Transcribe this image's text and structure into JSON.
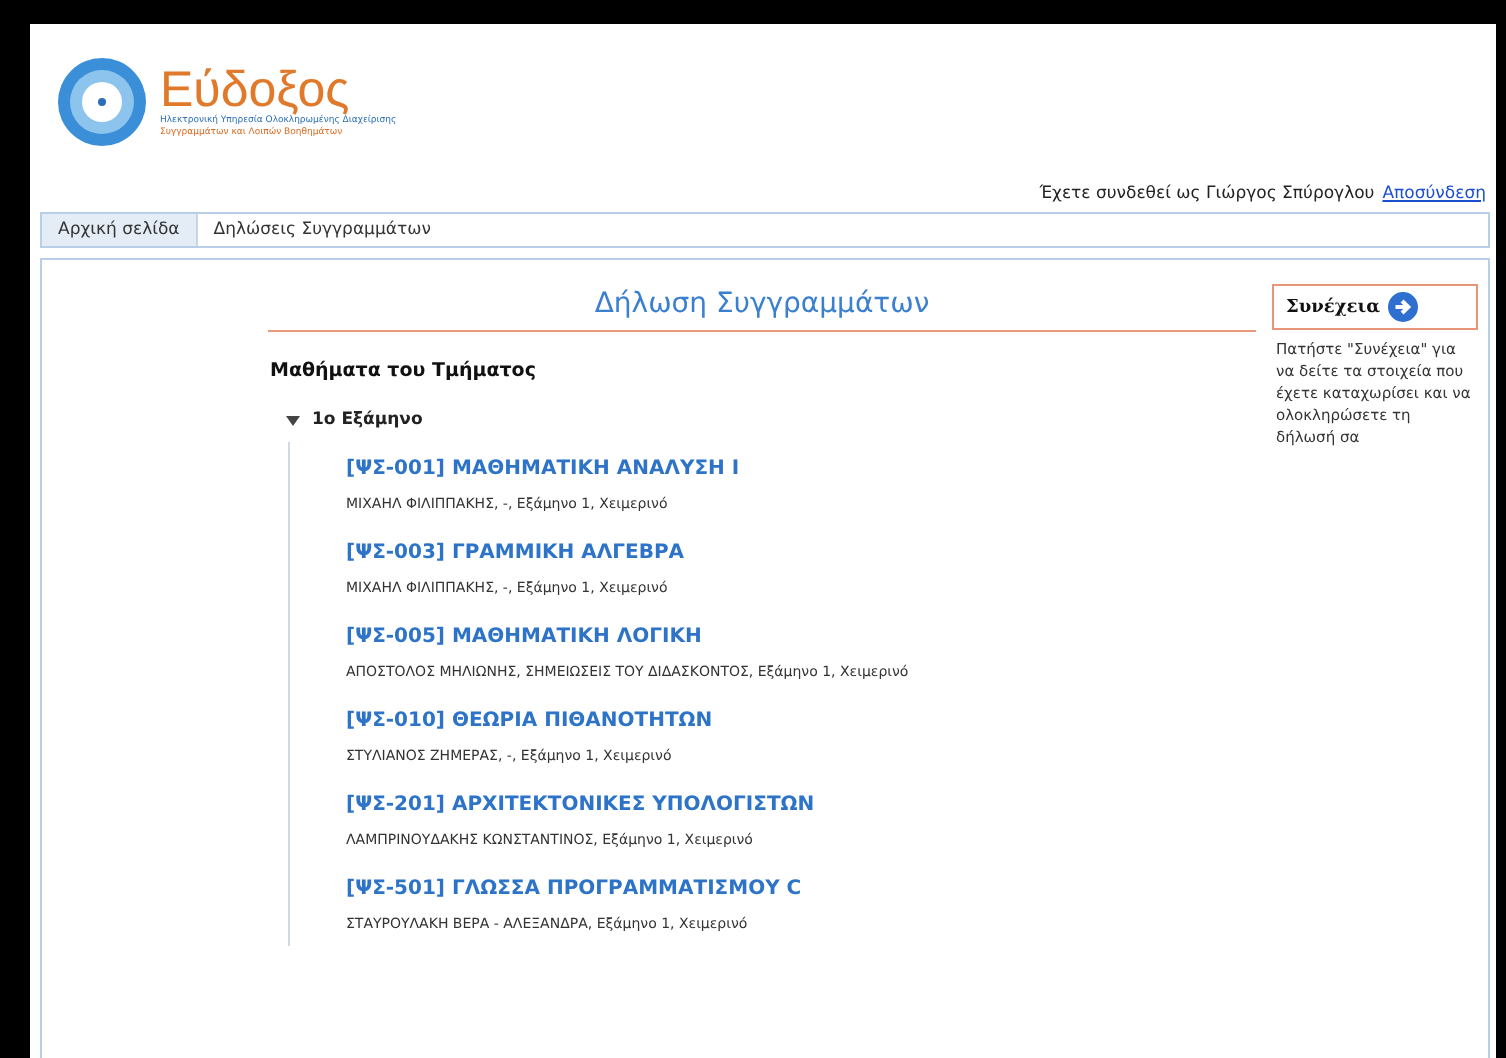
{
  "logo": {
    "name": "Εύδοξος",
    "subtitle_line_1": "Ηλεκτρονική Υπηρεσία Ολοκληρωμένης Διαχείρισης",
    "subtitle_line_2": "Συγγραμμάτων και Λοιπών Βοηθημάτων"
  },
  "login": {
    "text": "Έχετε συνδεθεί ως Γιώργος Σπύρογλου",
    "logout": "Αποσύνδεση"
  },
  "nav": [
    {
      "label": "Αρχική σελίδα",
      "selected": true
    },
    {
      "label": "Δηλώσεις Συγγραμμάτων",
      "selected": false
    }
  ],
  "main": {
    "title": "Δήλωση Συγγραμμάτων",
    "section": "Μαθήματα του Τμήματος",
    "semester": {
      "label": "1ο Εξάμηνο",
      "expanded": true,
      "courses": [
        {
          "title": "[ΨΣ-001] ΜΑΘΗΜΑΤΙΚΗ ΑΝΑΛΥΣΗ Ι",
          "details": "ΜΙΧΑΗΛ ΦΙΛΙΠΠΑΚΗΣ, -, Εξάμηνο 1, Χειμερινό"
        },
        {
          "title": "[ΨΣ-003] ΓΡΑΜΜΙΚΗ ΑΛΓΕΒΡΑ",
          "details": "ΜΙΧΑΗΛ ΦΙΛΙΠΠΑΚΗΣ, -, Εξάμηνο 1, Χειμερινό"
        },
        {
          "title": "[ΨΣ-005] ΜΑΘΗΜΑΤΙΚΗ ΛΟΓΙΚΗ",
          "details": "ΑΠΟΣΤΟΛΟΣ ΜΗΛΙΩΝΗΣ, ΣΗΜΕΙΩΣΕΙΣ ΤΟΥ ΔΙΔΑΣΚΟΝΤΟΣ, Εξάμηνο 1, Χειμερινό"
        },
        {
          "title": "[ΨΣ-010] ΘΕΩΡΙΑ ΠΙΘΑΝΟΤΗΤΩΝ",
          "details": "ΣΤΥΛΙΑΝΟΣ ΖΗΜΕΡΑΣ, -, Εξάμηνο 1, Χειμερινό"
        },
        {
          "title": "[ΨΣ-201] ΑΡΧΙΤΕΚΤΟΝΙΚΕΣ ΥΠΟΛΟΓΙΣΤΩΝ",
          "details": "ΛΑΜΠΡΙΝΟΥΔΑΚΗΣ ΚΩΝΣΤΑΝΤΙΝΟΣ, Εξάμηνο 1, Χειμερινό"
        },
        {
          "title": "[ΨΣ-501] ΓΛΩΣΣΑ ΠΡΟΓΡΑΜΜΑΤΙΣΜΟΥ C",
          "details": "ΣΤΑΥΡΟΥΛΑΚΗ ΒΕΡΑ - ΑΛΕΞΑΝΔΡΑ, Εξάμηνο 1, Χειμερινό"
        }
      ]
    }
  },
  "sidebar": {
    "button": "Συνέχεια",
    "help": "Πατήστε \"Συνέχεια\" για να δείτε τα στοιχεία που έχετε καταχωρίσει και να ολοκληρώσετε τη δήλωσή σα"
  }
}
